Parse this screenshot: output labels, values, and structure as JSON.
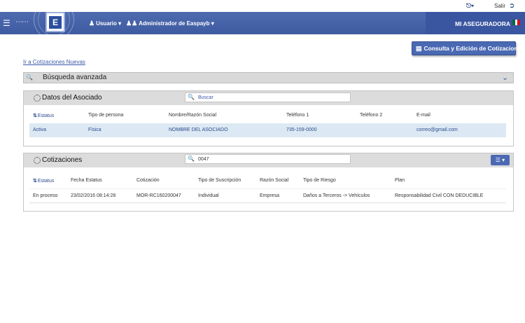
{
  "topbar": {
    "print_icon": "print-icon",
    "salir_label": "Salir",
    "exit_icon": "exit-icon"
  },
  "navbar": {
    "usuario_label": "Usuario",
    "admin_label": "Administrador de Easpayb",
    "brand_name": "MI ASEGURADORA",
    "logo_letter": "E",
    "flag_colors": [
      "#006847",
      "#ffffff",
      "#ce1126"
    ]
  },
  "actions": {
    "consulta_button": "Consulta y Edición de Cotizaciones",
    "nuevas_link": "Ir a Cotizaciones Nuevas"
  },
  "busqueda": {
    "label": "Búsqueda avanzada"
  },
  "asociado": {
    "title": "Datos del Asociado",
    "search_placeholder": "Buscar",
    "search_value": "",
    "headers": [
      "Estatus",
      "Tipo de persona",
      "Nombre/Razón Social",
      "Teléfono 1",
      "Teléfono 2",
      "E-mail"
    ],
    "rows": [
      {
        "estatus": "Activa",
        "tipo": "Física",
        "nombre": "NOMBRE DEL ASOCIADO",
        "tel1": "735-159-0000",
        "tel2": "",
        "email": "correo@gmail.com"
      }
    ]
  },
  "cotizaciones": {
    "title": "Cotizaciones",
    "search_value": "0047",
    "headers": [
      "Estatus",
      "Fecha Estatus",
      "Cotización",
      "Tipo de Suscripción",
      "Razón Social",
      "Tipo de Riesgo",
      "Plan"
    ],
    "rows": [
      {
        "estatus": "En proceso",
        "fecha": "23/02/2016 08:14:28",
        "cotizacion": "MOR-RC160200047",
        "suscripcion": "Individual",
        "razon": "Empresa",
        "riesgo": "Daños a Terceros -> Vehículos",
        "plan": "Responsabilidad Civil CON DEDUCIBLE"
      }
    ]
  },
  "colors": {
    "accent": "#4a69b3",
    "navbar": "#4f6bb0",
    "row_highlight": "#dce9f4"
  }
}
